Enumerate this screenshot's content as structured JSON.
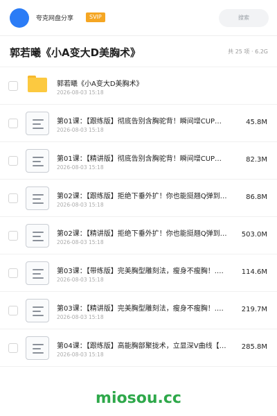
{
  "header": {
    "app_name": "夸克网盘分享",
    "badge": "SVIP",
    "search_placeholder": "搜索"
  },
  "folder": {
    "title": "郭若曦《小A变大D美胸术》",
    "meta": "共 25 项 · 6.2G"
  },
  "items": [
    {
      "type": "folder",
      "name": "郭若曦《小A变大D美胸术》",
      "date": "2026-08-03 15:18",
      "size": ""
    },
    {
      "type": "file",
      "name": "第01课：【跟练版】彻底告别含胸驼背！瞬间增CUP…",
      "date": "2026-08-03 15:18",
      "size": "45.8M"
    },
    {
      "type": "file",
      "name": "第01课：【精讲版】彻底告别含胸驼背！瞬间增CUP…",
      "date": "2026-08-03 15:18",
      "size": "82.3M"
    },
    {
      "type": "file",
      "name": "第02课：【跟练版】拒绝下垂外扩！你也能挺翘Q弹到…",
      "date": "2026-08-03 15:18",
      "size": "86.8M"
    },
    {
      "type": "file",
      "name": "第02课：【精讲版】拒绝下垂外扩！你也能挺翘Q弹到…",
      "date": "2026-08-03 15:18",
      "size": "503.0M"
    },
    {
      "type": "file",
      "name": "第03课：【带练版】完美胸型雕刻法，瘦身不瘦胸！.…",
      "date": "2026-08-03 15:18",
      "size": "114.6M"
    },
    {
      "type": "file",
      "name": "第03课：【精讲版】完美胸型雕刻法，瘦身不瘦胸！.…",
      "date": "2026-08-03 15:18",
      "size": "219.7M"
    },
    {
      "type": "file",
      "name": "第04课：【跟练版】高能胸部聚拢术，立显深V曲线【…",
      "date": "2026-08-03 15:18",
      "size": "285.8M"
    }
  ],
  "watermark": "miosou.cc"
}
